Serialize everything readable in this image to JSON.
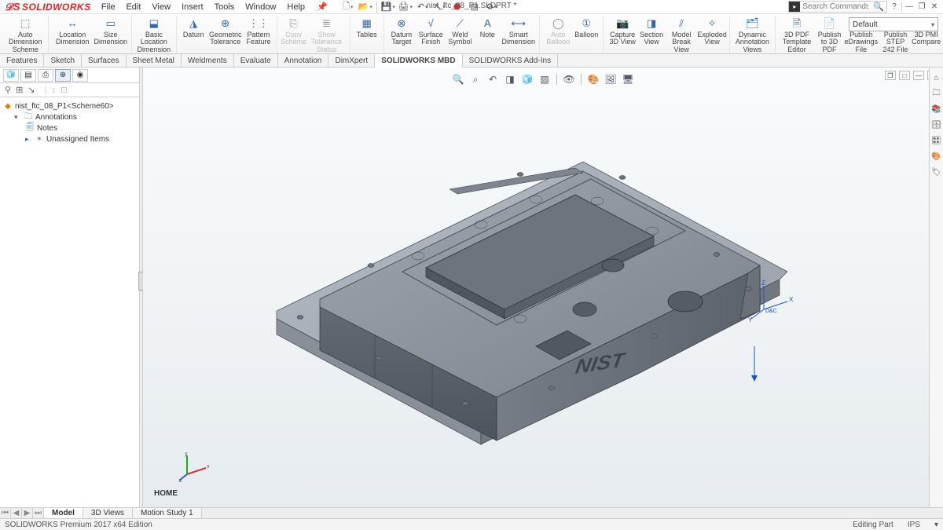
{
  "app": {
    "name": "SOLIDWORKS",
    "title": "nist_ftc_08_P1.SLDPRT *"
  },
  "menu": {
    "items": [
      "File",
      "Edit",
      "View",
      "Insert",
      "Tools",
      "Window",
      "Help"
    ]
  },
  "search": {
    "placeholder": "Search Commands"
  },
  "config": {
    "selected": "Default"
  },
  "ribbon": {
    "buttons": [
      {
        "label": "Auto Dimension Scheme"
      },
      {
        "label": "Location Dimension"
      },
      {
        "label": "Size Dimension"
      },
      {
        "label": "Basic Location Dimension"
      },
      {
        "label": "Datum"
      },
      {
        "label": "Geometric Tolerance"
      },
      {
        "label": "Pattern Feature"
      },
      {
        "label": "Copy Scheme",
        "disabled": true
      },
      {
        "label": "Show Tolerance Status",
        "disabled": true
      },
      {
        "label": "Tables"
      },
      {
        "label": "Datum Target"
      },
      {
        "label": "Surface Finish"
      },
      {
        "label": "Weld Symbol"
      },
      {
        "label": "Note"
      },
      {
        "label": "Smart Dimension"
      },
      {
        "label": "Auto Balloon",
        "disabled": true
      },
      {
        "label": "Balloon"
      },
      {
        "label": "Capture 3D View"
      },
      {
        "label": "Section View"
      },
      {
        "label": "Model Break View"
      },
      {
        "label": "Exploded View"
      },
      {
        "label": "Dynamic Annotation Views"
      },
      {
        "label": "3D PDF Template Editor"
      },
      {
        "label": "Publish to 3D PDF"
      },
      {
        "label": "Publish eDrawings File"
      },
      {
        "label": "Publish STEP 242 File"
      },
      {
        "label": "3D PMI Compare"
      }
    ]
  },
  "cm_tabs": [
    "Features",
    "Sketch",
    "Surfaces",
    "Sheet Metal",
    "Weldments",
    "Evaluate",
    "Annotation",
    "DimXpert",
    "SOLIDWORKS MBD",
    "SOLIDWORKS Add-Ins"
  ],
  "cm_active": "SOLIDWORKS MBD",
  "tree": {
    "root": "nist_ftc_08_P1<Scheme60>",
    "annotations": "Annotations",
    "notes": "Notes",
    "unassigned": "Unassigned Items"
  },
  "doc_tabs": {
    "items": [
      "Model",
      "3D Views",
      "Motion Study 1"
    ],
    "active": "Model"
  },
  "view": {
    "name": "HOME"
  },
  "status": {
    "left": "SOLIDWORKS Premium 2017 x64 Edition",
    "mode": "Editing Part",
    "units": "IPS"
  },
  "triad": {
    "axes": [
      "x",
      "y",
      "z"
    ]
  },
  "origin": {
    "axes": [
      "X",
      "Y",
      "Z"
    ],
    "label": "D&C"
  }
}
